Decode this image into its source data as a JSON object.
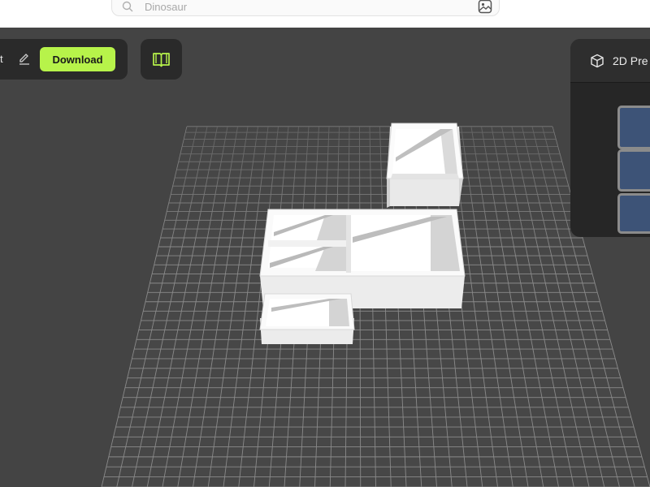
{
  "search": {
    "placeholder": "Dinosaur"
  },
  "toolbar": {
    "cut_label": "t",
    "download_label": "Download"
  },
  "preview": {
    "title": "2D Pre"
  },
  "colors": {
    "accent": "#b7f34a",
    "panel": "#2a2a2a",
    "canvas": "#444444",
    "tile": "#3d5377"
  },
  "icons": [
    "search-icon",
    "image-search-icon",
    "pencil-icon",
    "book-icon",
    "cube-icon"
  ]
}
